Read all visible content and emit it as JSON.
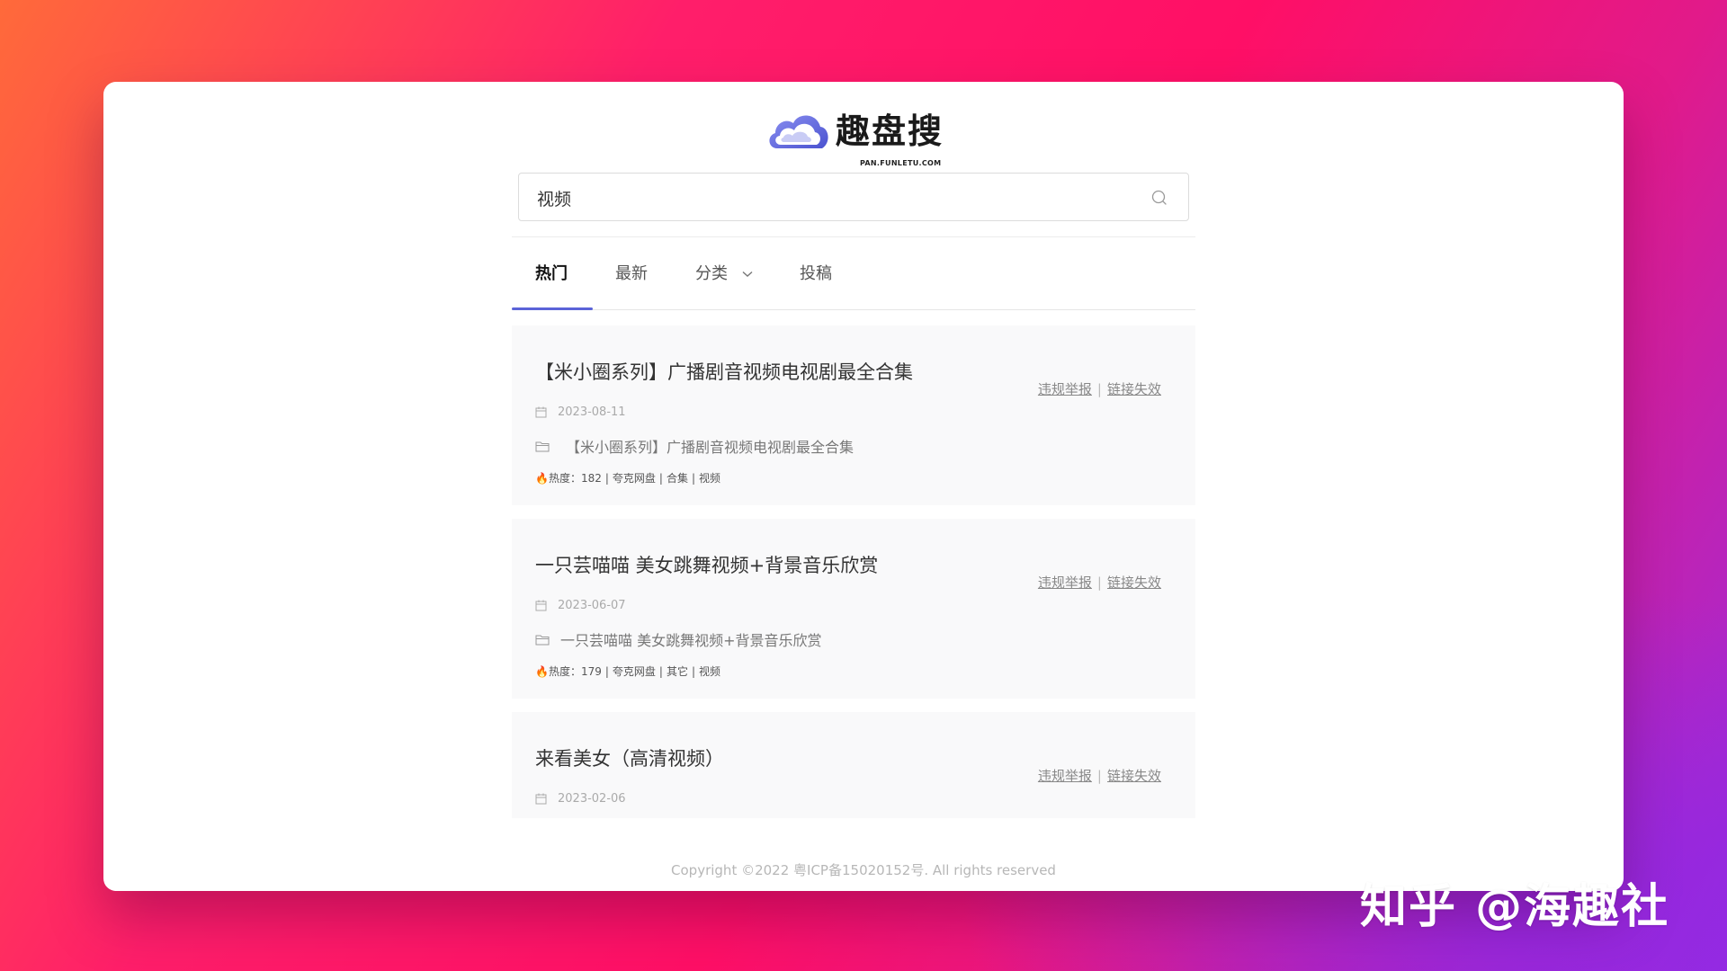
{
  "logo": {
    "name": "趣盘搜",
    "domain": "PAN.FUNLETU.COM"
  },
  "search": {
    "value": "视频"
  },
  "tabs": [
    {
      "label": "热门",
      "active": true
    },
    {
      "label": "最新",
      "active": false
    },
    {
      "label": "分类",
      "active": false,
      "dropdown": true
    },
    {
      "label": "投稿",
      "active": false
    }
  ],
  "actions": {
    "report": "违规举报",
    "separator": "|",
    "invalid": "链接失效"
  },
  "results": [
    {
      "title": "【米小圈系列】广播剧音视频电视剧最全合集",
      "date": "2023-08-11",
      "folder": "【米小圈系列】广播剧音视频电视剧最全合集",
      "heat_label": "🔥热度：",
      "heat": "182",
      "source": "夸克网盘",
      "category": "合集",
      "tag": "视频"
    },
    {
      "title": "一只芸喵喵 美女跳舞视频+背景音乐欣赏",
      "date": "2023-06-07",
      "folder": "一只芸喵喵 美女跳舞视频+背景音乐欣赏",
      "heat_label": "🔥热度：",
      "heat": "179",
      "source": "夸克网盘",
      "category": "其它",
      "tag": "视频"
    },
    {
      "title": "来看美女（高清视频）",
      "date": "2023-02-06"
    }
  ],
  "footer": "Copyright ©2022 粤ICP备15020152号. All rights reserved",
  "watermark": "知乎 @海趣社",
  "colors": {
    "accent": "#5b63d8",
    "card_bg": "#ffffff",
    "result_bg": "#f9f9fa"
  }
}
